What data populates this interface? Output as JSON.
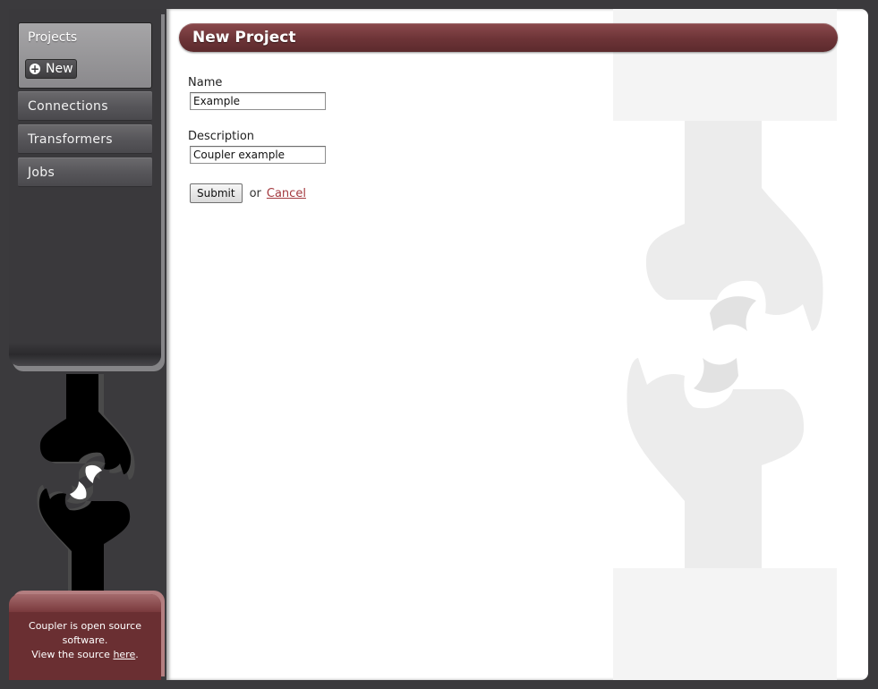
{
  "sidebar": {
    "projects_label": "Projects",
    "new_button_label": "New",
    "nav_items": [
      {
        "label": "Connections"
      },
      {
        "label": "Transformers"
      },
      {
        "label": "Jobs"
      }
    ]
  },
  "footer": {
    "line1": "Coupler is open source software.",
    "line2_prefix": "View the source ",
    "link_label": "here",
    "line2_suffix": "."
  },
  "main": {
    "title": "New Project",
    "form": {
      "name_label": "Name",
      "name_value": "Example",
      "description_label": "Description",
      "description_value": "Coupler example",
      "submit_label": "Submit",
      "or_text": "or",
      "cancel_label": "Cancel"
    }
  },
  "colors": {
    "brand": "#6d3437",
    "sidebar": "#3a393c",
    "link": "#a3393e"
  },
  "icons": {
    "new_button": "plus-circle-icon",
    "logo": "coupler-logo",
    "watermark": "coupler-logo-watermark"
  }
}
